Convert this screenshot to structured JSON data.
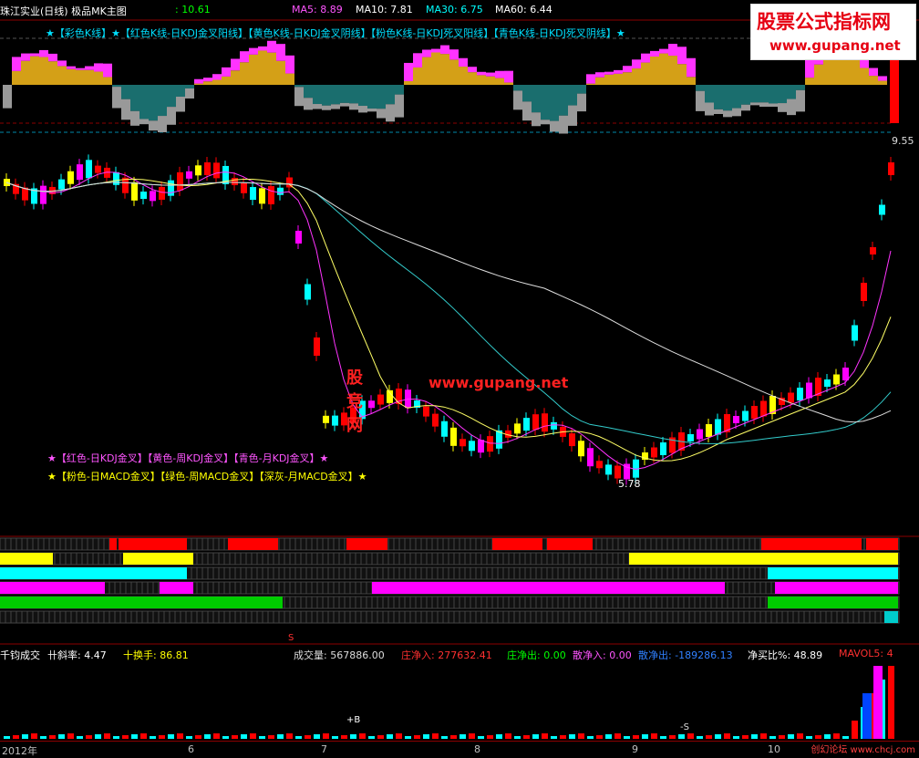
{
  "header": {
    "stock_title": "珠江实业(日线) 极品MK主图",
    "last_price": ": 10.61",
    "ma5": "MA5: 8.89",
    "ma10": "MA10: 7.81",
    "ma30": "MA30: 6.75",
    "ma60": "MA60: 6.44"
  },
  "legend_top": "★【彩色K线】★【红色K线-日KDJ金叉阳线】【黄色K线-日KDJ金叉阴线】【粉色K线-日KDJ死叉阳线】【青色K线-日KDJ死叉阴线】★",
  "legend_mid1": "★【红色-日KDJ金叉】【黄色-周KDJ金叉】【青色-月KDJ金叉】★",
  "legend_mid2": "★【粉色-日MACD金叉】【绿色-周MACD金叉】【深灰-月MACD金叉】★",
  "price_labels": {
    "right_price": "9.55",
    "low_price": "5.78"
  },
  "overlays": {
    "site_cn": "股竞网",
    "site_url": "www.gupang.net",
    "wm_title": "股票公式指标网",
    "wm_url": "www.gupang.net",
    "corner": "创幻论坛 www.chcj.com"
  },
  "volume_bar": {
    "title": "千钧成交",
    "slope": "卄斜率: 4.47",
    "turnover": "十换手: 86.81",
    "volume": "成交量: 567886.00",
    "main_in": "庄净入: 277632.41",
    "main_out": "庄净出: 0.00",
    "retail_in": "散净入: 0.00",
    "retail_out": "散净出: -189286.13",
    "net_buy": "净买比%: 48.89",
    "mavol": "MAVOL5: 4"
  },
  "signals": {
    "buy_mark": "+B",
    "sell_mark": "-S",
    "s_top": "S"
  },
  "dates": [
    "2012年",
    "6",
    "7",
    "8",
    "9",
    "10"
  ],
  "colors": {
    "up": "#ff0000",
    "down": "#00ffff",
    "yellow": "#ffff00",
    "magenta": "#ff00ff",
    "green": "#00cc00",
    "grid": "#333333"
  }
}
